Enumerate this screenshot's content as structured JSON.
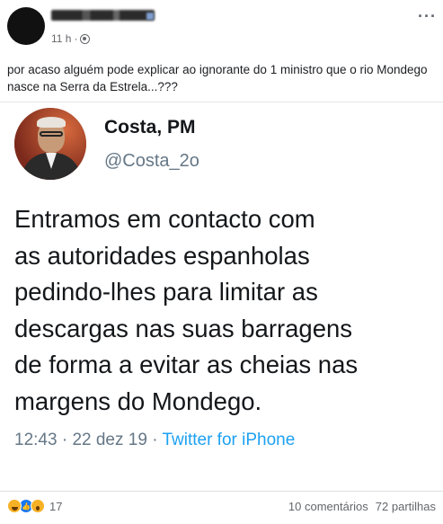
{
  "post": {
    "author_name": "",
    "time": "11 h",
    "separator": "·",
    "more_label": "···",
    "text": "por acaso alguém pode explicar ao ignorante do 1 ministro que o rio Mondego nasce na Serra da Estrela...???"
  },
  "tweet": {
    "name": "Costa, PM",
    "handle": "@Costa_2o",
    "lines": [
      "Entramos em contacto com",
      "as autoridades espanholas",
      "pedindo-lhes para limitar as",
      "descargas nas suas barragens",
      "de forma a evitar as cheias nas",
      "margens do Mondego."
    ],
    "time": "12:43",
    "date": "22 dez 19",
    "separator": "·",
    "source": "Twitter for iPhone"
  },
  "stats": {
    "reaction_count": "17",
    "comments": "10 comentários",
    "shares": "72 partilhas"
  },
  "icons": {
    "privacy": "globe-icon",
    "more": "more-options-icon",
    "reactions": [
      "haha-reaction-icon",
      "like-reaction-icon",
      "wow-reaction-icon"
    ]
  },
  "colors": {
    "twitter_blue": "#1da1f2",
    "facebook_blue": "#1877f2",
    "meta_gray": "#65676b"
  }
}
